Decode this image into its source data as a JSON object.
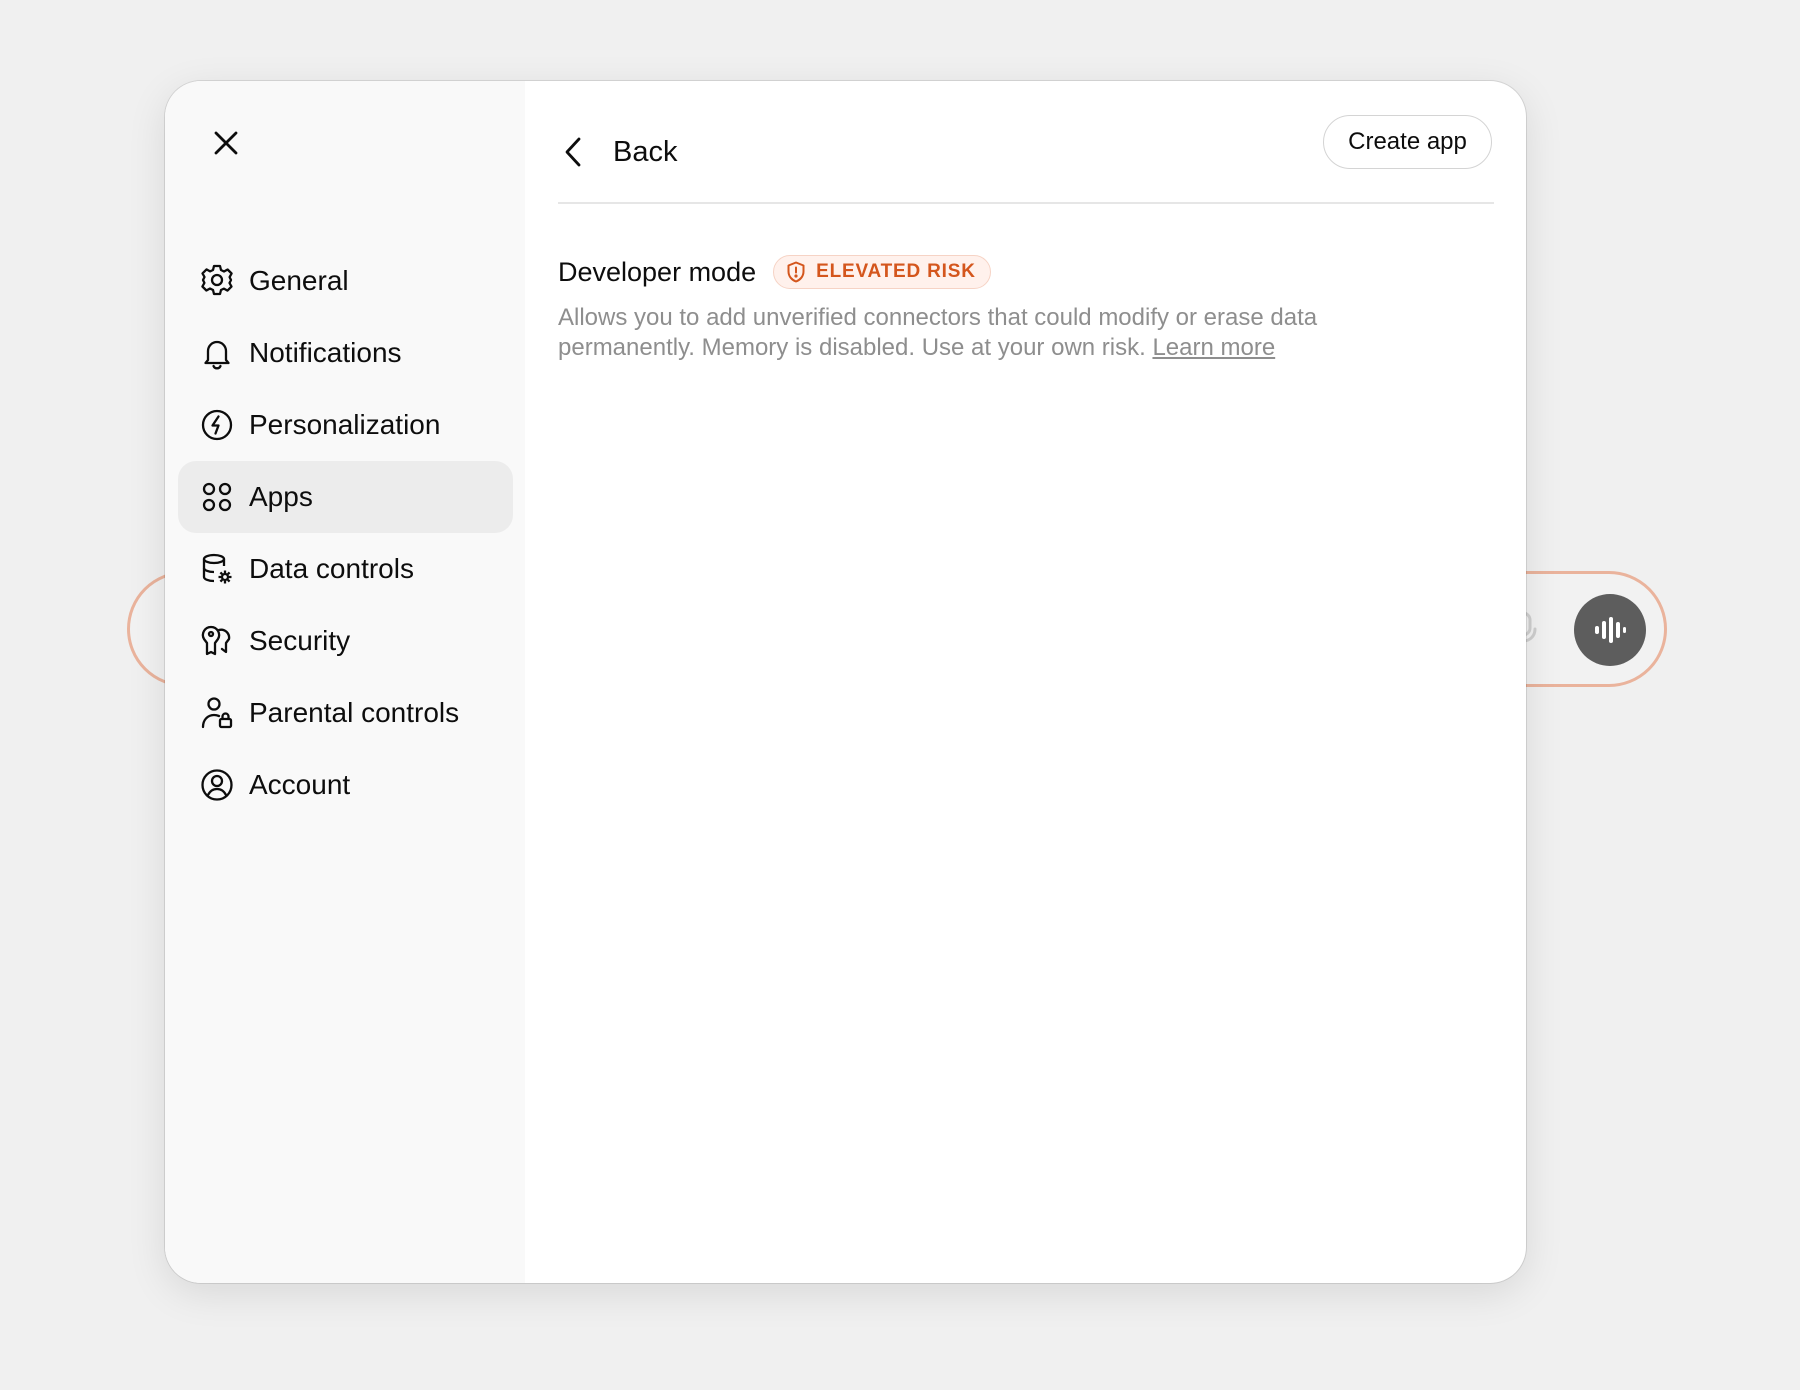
{
  "sidebar": {
    "close_icon": "close-icon",
    "items": [
      {
        "label": "General",
        "icon": "gear-icon"
      },
      {
        "label": "Notifications",
        "icon": "bell-icon"
      },
      {
        "label": "Personalization",
        "icon": "personalization-icon"
      },
      {
        "label": "Apps",
        "icon": "apps-grid-icon",
        "active": true
      },
      {
        "label": "Data controls",
        "icon": "data-controls-icon"
      },
      {
        "label": "Security",
        "icon": "security-key-icon"
      },
      {
        "label": "Parental controls",
        "icon": "parental-controls-icon"
      },
      {
        "label": "Account",
        "icon": "account-icon"
      }
    ]
  },
  "header": {
    "back_label": "Back",
    "create_app_label": "Create app"
  },
  "developer_mode": {
    "title": "Developer mode",
    "badge": "ELEVATED RISK",
    "description": "Allows you to add unverified connectors that could modify or erase data permanently. Memory is disabled. Use at your own risk.",
    "learn_more": "Learn more",
    "enabled": true
  },
  "colors": {
    "accent_blue": "#3b82f6",
    "risk_orange": "#d4561d",
    "annotation_green": "#9af29a"
  }
}
